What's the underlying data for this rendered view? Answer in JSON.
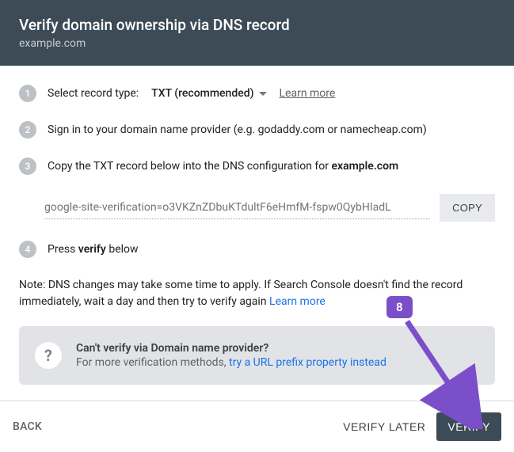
{
  "header": {
    "title": "Verify domain ownership via DNS record",
    "subtitle": "example.com"
  },
  "steps": {
    "s1": {
      "num": "1",
      "label": "Select record type:",
      "selectValue": "TXT (recommended)",
      "learnMore": "Learn more"
    },
    "s2": {
      "num": "2",
      "text": "Sign in to your domain name provider (e.g. godaddy.com or namecheap.com)"
    },
    "s3": {
      "num": "3",
      "prefix": "Copy the TXT record below into the DNS configuration for ",
      "domain": "example.com"
    },
    "s4": {
      "num": "4",
      "prefix": "Press ",
      "bold": "verify",
      "suffix": " below"
    }
  },
  "txt": {
    "value": "google-site-verification=o3VKZnZDbuKTdultF6eHmfM-fspw0QybHIadL",
    "copy": "COPY"
  },
  "note": {
    "text": "Note: DNS changes may take some time to apply. If Search Console doesn't find the record immediately, wait a day and then try to verify again ",
    "link": "Learn more"
  },
  "info": {
    "iconGlyph": "?",
    "title": "Can't verify via Domain name provider?",
    "subPrefix": "For more verification methods, ",
    "subLink": "try a URL prefix property instead"
  },
  "footer": {
    "back": "BACK",
    "verifyLater": "VERIFY LATER",
    "verify": "VERIFY"
  },
  "annotation": {
    "label": "8"
  }
}
